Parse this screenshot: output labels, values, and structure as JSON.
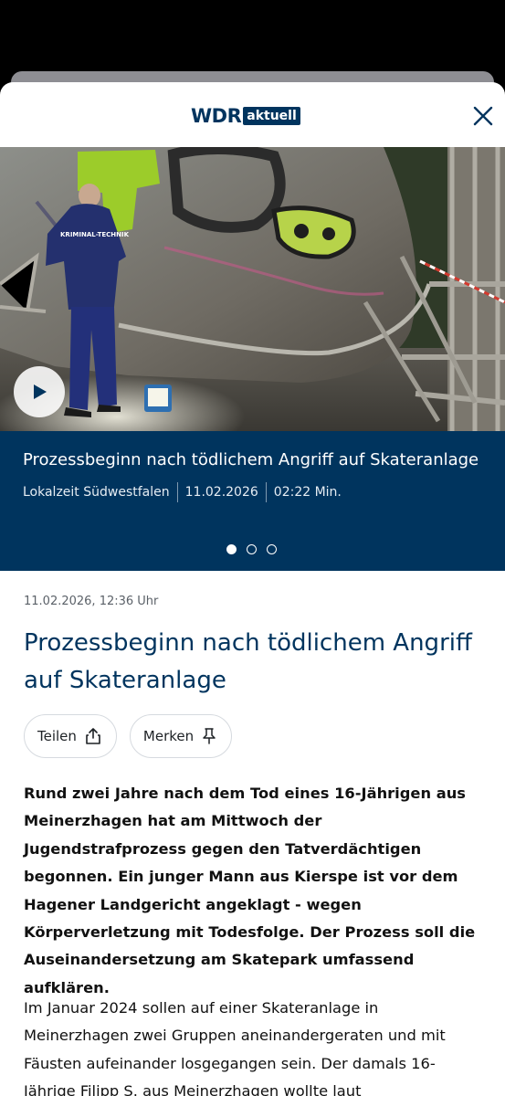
{
  "header": {
    "logo_main": "WDR",
    "logo_badge": "aktuell",
    "close_icon": "close-icon"
  },
  "hero": {
    "play_icon": "play-icon",
    "image_text": "KRIMINAL-TECHNIK"
  },
  "caption": {
    "title": "Prozessbeginn nach tödlichem Angriff auf Skateranlage",
    "source": "Lokalzeit Südwestfalen",
    "date": "11.02.2026",
    "duration": "02:22 Min.",
    "slide_count": 3,
    "active_slide": 1
  },
  "article": {
    "date": "11.02.2026, 12:36 Uhr",
    "headline": "Prozessbeginn nach tödlichem Angriff auf Skateranlage",
    "share_label": "Teilen",
    "bookmark_label": "Merken",
    "lead": "Rund zwei Jahre nach dem Tod eines 16-Jährigen aus Meinerzhagen hat am Mittwoch der Jugendstrafprozess gegen den Tatverdächtigen begonnen. Ein junger Mann aus Kierspe ist vor dem Hagener Landgericht angeklagt - wegen Körperverletzung mit Todesfolge. Der Prozess soll die Auseinandersetzung am Skatepark umfassend aufklären.",
    "body": "Im Januar 2024 sollen auf einer Skateranlage in Meinerzhagen zwei Gruppen aneinandergeraten und mit Fäusten aufeinander losgegangen sein. Der damals 16-Jährige Filipp S. aus Meinerzhagen wollte laut"
  },
  "colors": {
    "brand": "#00345e",
    "background": "#ffffff"
  }
}
